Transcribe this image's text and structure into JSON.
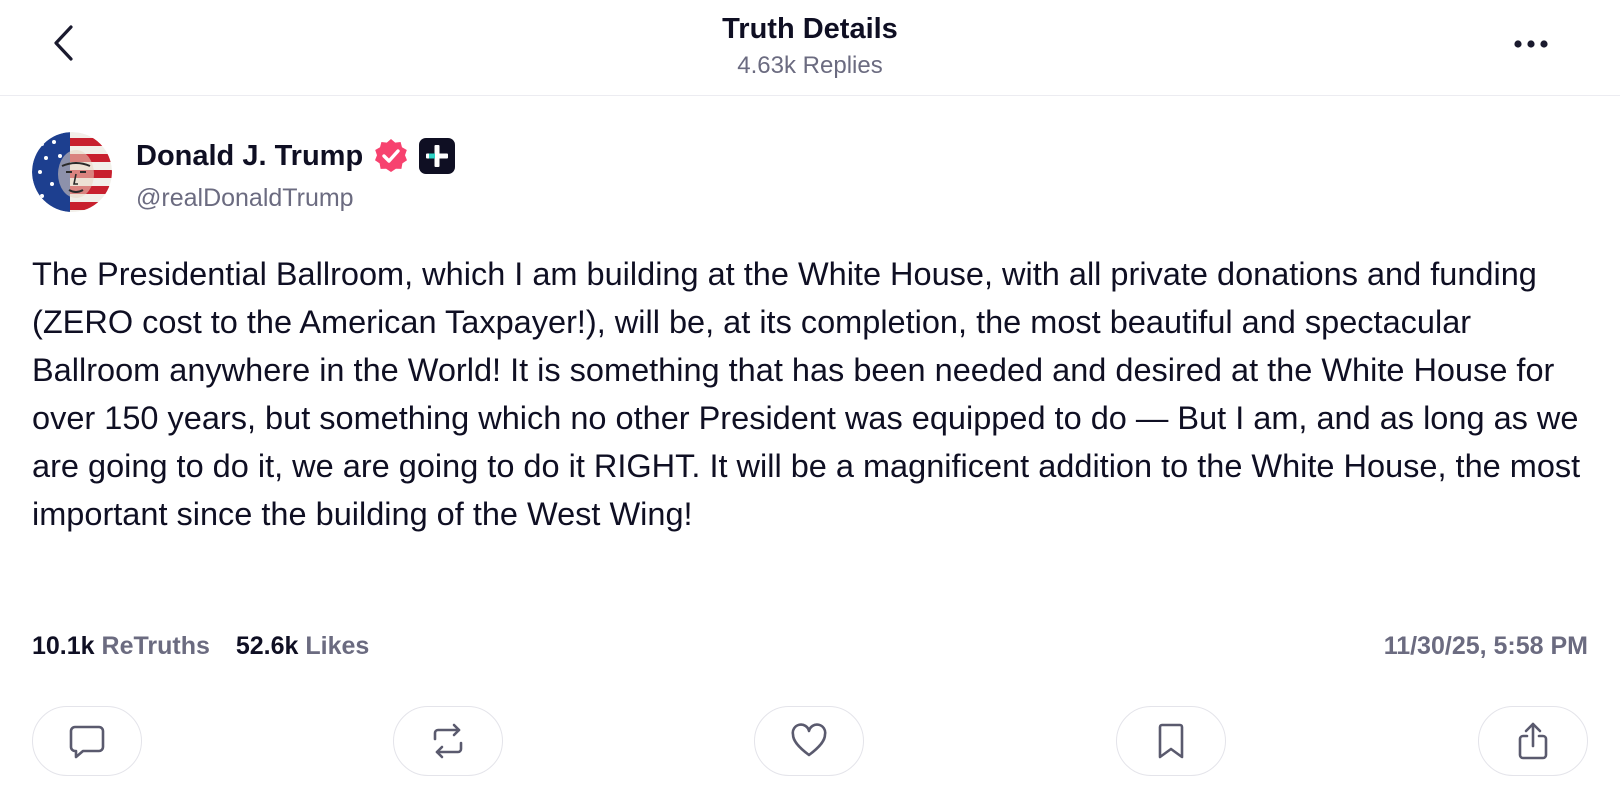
{
  "header": {
    "title": "Truth Details",
    "subtitle": "4.63k Replies",
    "back_icon": "chevron-left-icon",
    "more_icon": "ellipsis-icon"
  },
  "author": {
    "name": "Donald J. Trump",
    "handle": "@realDonaldTrump",
    "verified_color": "#f7426f"
  },
  "post": {
    "text": "The Presidential Ballroom, which I am building at the White House, with all private donations and funding (ZERO cost to the American Taxpayer!), will be, at its completion, the most beautiful and spectacular Ballroom anywhere in the World! It is something that has been needed and desired at the White House for over 150 years, but something which no other President was equipped to do — But I am, and as long as we are going to do it, we are going to do it RIGHT. It will be a magnificent addition to the White House, the most important since the building of the West Wing!"
  },
  "stats": {
    "retruths_count": "10.1k",
    "retruths_label": "ReTruths",
    "likes_count": "52.6k",
    "likes_label": "Likes",
    "timestamp": "11/30/25, 5:58 PM"
  },
  "actions": [
    {
      "name": "reply",
      "icon": "comment-icon"
    },
    {
      "name": "retruth",
      "icon": "repost-icon"
    },
    {
      "name": "like",
      "icon": "heart-icon"
    },
    {
      "name": "bookmark",
      "icon": "bookmark-icon"
    },
    {
      "name": "share",
      "icon": "share-icon"
    }
  ]
}
